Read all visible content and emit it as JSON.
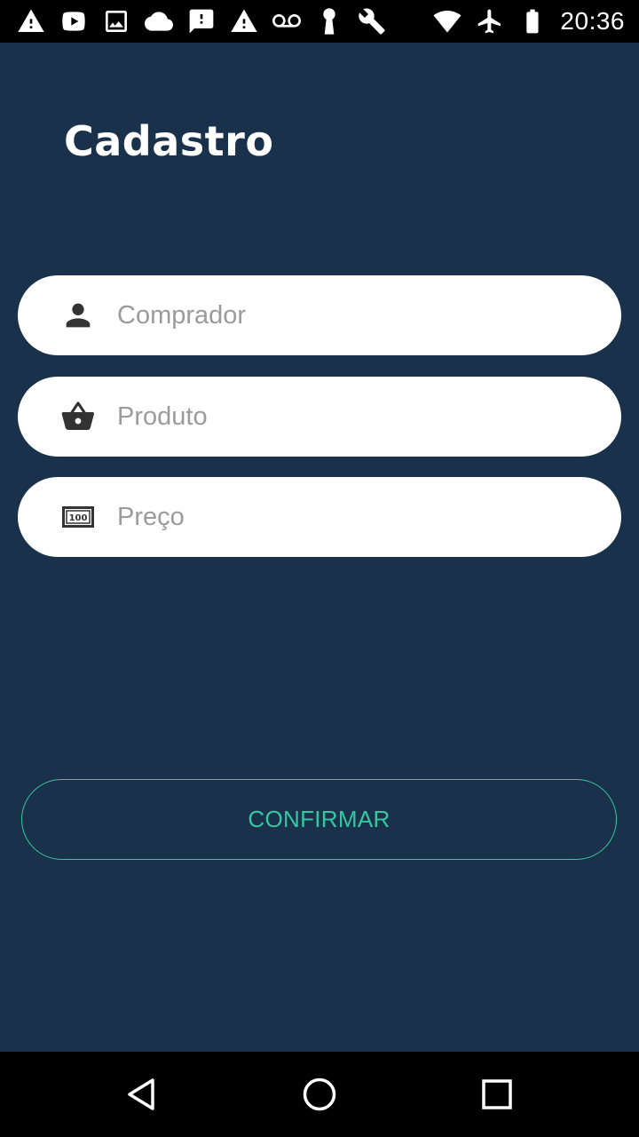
{
  "status_bar": {
    "time": "20:36",
    "left_icons": [
      "warning-icon",
      "youtube-icon",
      "image-icon",
      "cloud-icon",
      "alert-message-icon",
      "warning-icon",
      "voicemail-icon",
      "keyhole-icon",
      "wrench-icon"
    ],
    "right_icons": [
      "wifi-icon",
      "airplane-mode-icon",
      "battery-icon"
    ]
  },
  "screen": {
    "title": "Cadastro",
    "background_color": "#19314a"
  },
  "form": {
    "buyer": {
      "placeholder": "Comprador",
      "value": "",
      "icon": "person-icon"
    },
    "product": {
      "placeholder": "Produto",
      "value": "",
      "icon": "shopping-basket-icon"
    },
    "price": {
      "placeholder": "Preço",
      "value": "",
      "icon": "money-bill-icon"
    }
  },
  "confirm_button": {
    "label": "CONFIRMAR",
    "accent_color": "#35c7a0"
  },
  "nav_bar": {
    "buttons": [
      "back-icon",
      "home-icon",
      "recent-apps-icon"
    ]
  }
}
